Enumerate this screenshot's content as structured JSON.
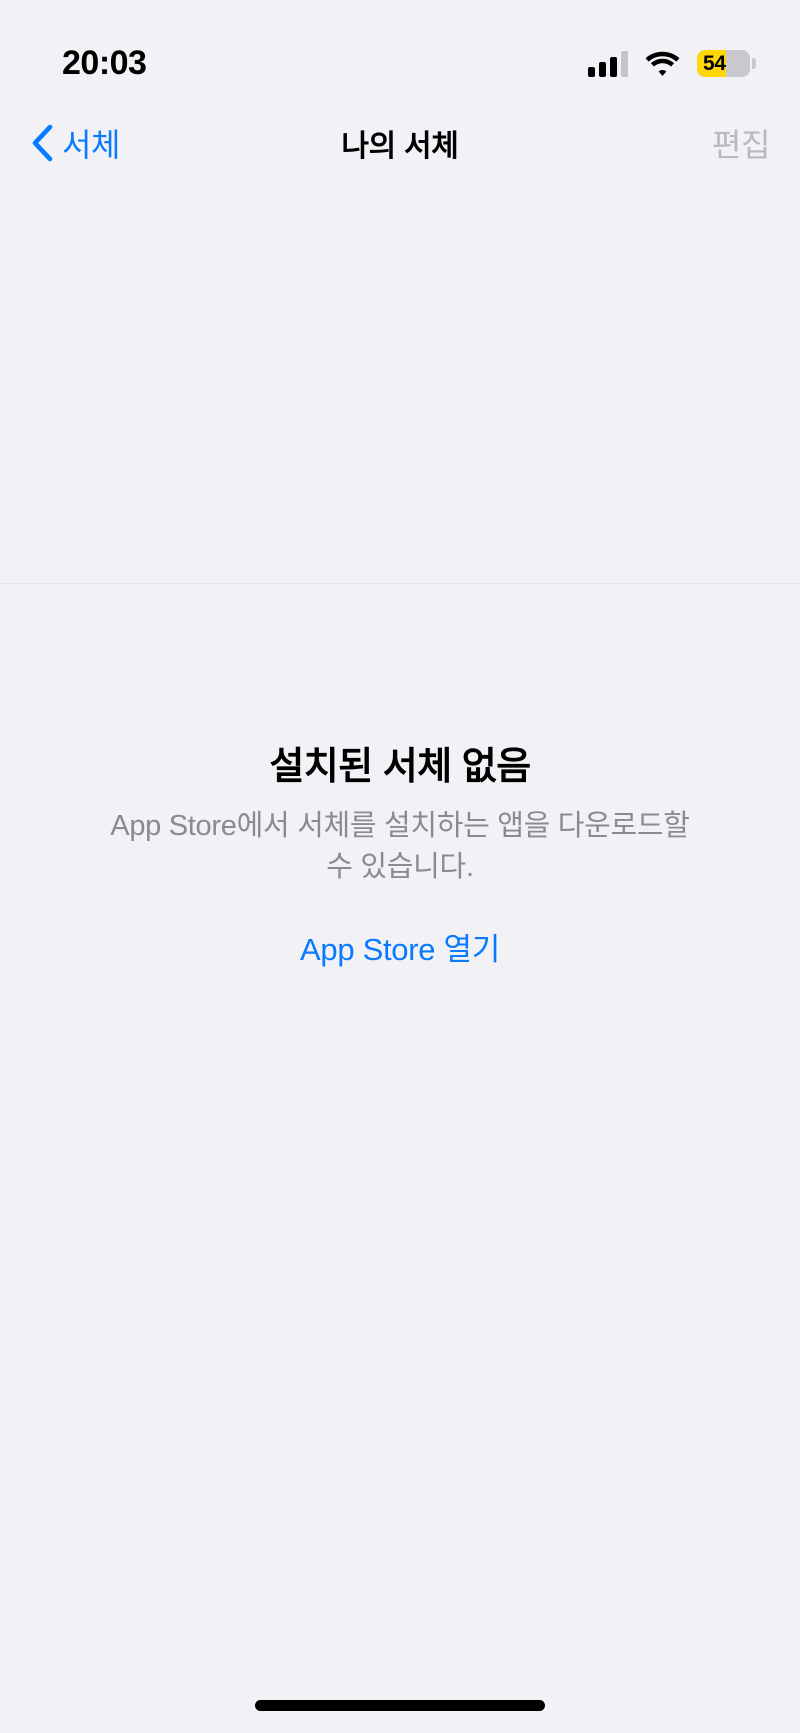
{
  "status_bar": {
    "time": "20:03",
    "cellular_icon": "signal-bars-icon",
    "cellular_bars_filled": 3,
    "cellular_bars_total": 4,
    "wifi_icon": "wifi-icon",
    "battery_icon": "battery-icon",
    "battery_level": "54",
    "battery_percent": 54,
    "battery_low_power_mode": true,
    "battery_color": "#ffd60a"
  },
  "nav_bar": {
    "back_icon": "chevron-left-icon",
    "back_label": "서체",
    "title": "나의 서체",
    "edit_label": "편집",
    "edit_enabled": false,
    "tint_color": "#0a7aff",
    "disabled_color": "#b9b8be"
  },
  "empty_state": {
    "title": "설치된 서체 없음",
    "description": "App Store에서 서체를 설치하는 앱을 다운로드할 수 있습니다.",
    "action_label": "App Store 열기",
    "action_color": "#0a7aff"
  },
  "home_indicator": {
    "label": "home-indicator"
  },
  "theme": {
    "background": "#f2f1f6",
    "separator": "#e4e3e9",
    "text_primary": "#000000",
    "text_secondary": "#8b8a91"
  }
}
